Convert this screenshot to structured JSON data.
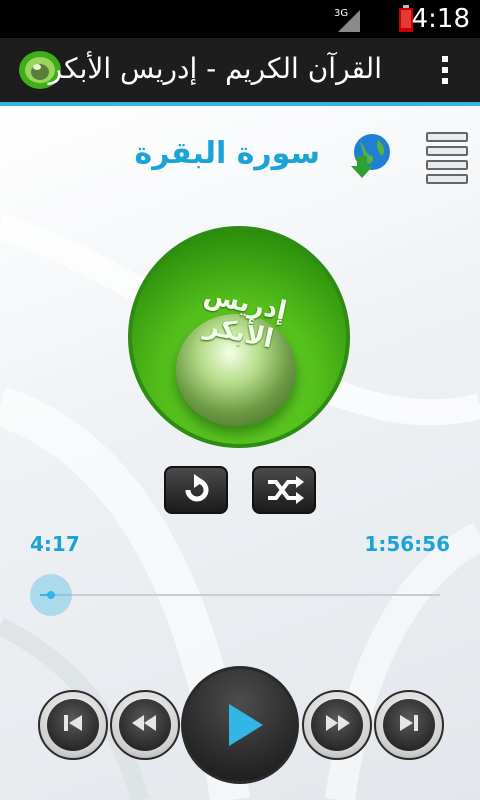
{
  "status_bar": {
    "network": "3G",
    "time": "4:18"
  },
  "action_bar": {
    "title": "القرآن الكريم - إدريس الأبكر"
  },
  "player": {
    "surah_title": "سورة البقرة",
    "cover_text": "إدريس الأبكر",
    "elapsed": "4:17",
    "duration": "1:56:56",
    "progress": 0.036
  },
  "icons": {
    "app": "quran-globe-icon",
    "overflow": "overflow-menu-icon",
    "download": "globe-download-icon",
    "playlist": "list-icon",
    "repeat": "repeat-icon",
    "shuffle": "shuffle-icon",
    "first": "skip-first-icon",
    "rewind": "rewind-icon",
    "play": "play-icon",
    "forward": "fast-forward-icon",
    "last": "skip-last-icon"
  },
  "colors": {
    "accent": "#33b5e5",
    "title_text": "#1aa3d4",
    "cover_green": "#56c21c"
  }
}
